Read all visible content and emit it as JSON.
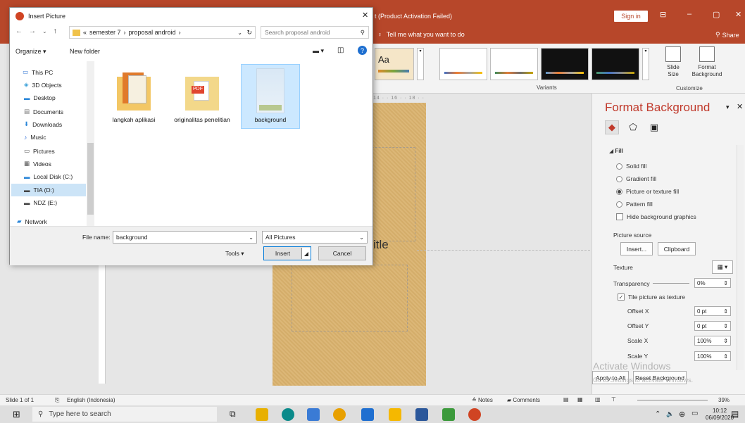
{
  "app": {
    "title": "t (Product Activation Failed)",
    "sign_in": "Sign in",
    "tell_me": "Tell me what you want to do",
    "share": "Share",
    "win_controls": [
      "⊟",
      "–",
      "▢",
      "✕"
    ]
  },
  "ribbon": {
    "variants_label": "Variants",
    "customize_label": "Customize",
    "theme_label": "Aa",
    "slide_size": "Slide\nSize",
    "format_background": "Format\nBackground"
  },
  "dialog": {
    "title": "Insert Picture",
    "breadcrumb": [
      "«",
      "semester 7",
      "›",
      "proposal android",
      "›"
    ],
    "search_placeholder": "Search proposal android",
    "organize": "Organize ▾",
    "new_folder": "New folder",
    "nav_items": [
      {
        "label": "This PC",
        "icon": "pc-icon"
      },
      {
        "label": "3D Objects",
        "icon": "cube-icon"
      },
      {
        "label": "Desktop",
        "icon": "desktop-icon"
      },
      {
        "label": "Documents",
        "icon": "document-icon"
      },
      {
        "label": "Downloads",
        "icon": "download-icon"
      },
      {
        "label": "Music",
        "icon": "music-icon"
      },
      {
        "label": "Pictures",
        "icon": "pictures-icon"
      },
      {
        "label": "Videos",
        "icon": "video-icon"
      },
      {
        "label": "Local Disk (C:)",
        "icon": "disk-icon"
      },
      {
        "label": "TIA (D:)",
        "icon": "drive-icon"
      },
      {
        "label": "NDZ (E:)",
        "icon": "drive-icon"
      },
      {
        "label": "Network",
        "icon": "network-icon"
      }
    ],
    "files": [
      {
        "name": "langkah aplikasi",
        "icon": "folder-icon"
      },
      {
        "name": "originalitas penelitian",
        "icon": "folder-pdf-icon"
      },
      {
        "name": "background",
        "icon": "image-file-icon"
      }
    ],
    "filename_label": "File name:",
    "filename_value": "background",
    "filetype": "All Pictures",
    "tools": "Tools",
    "insert": "Insert",
    "cancel": "Cancel"
  },
  "slide": {
    "title_fragment": "itle"
  },
  "format_panel": {
    "title": "Format Background",
    "fill_header": "Fill",
    "options": [
      "Solid fill",
      "Gradient fill",
      "Picture or texture fill",
      "Pattern fill"
    ],
    "selected_option": 2,
    "hide_bg": "Hide background graphics",
    "picture_source": "Picture source",
    "insert_btn": "Insert...",
    "clipboard_btn": "Clipboard",
    "texture": "Texture",
    "transparency": "Transparency",
    "transparency_value": "0%",
    "tile": "Tile picture as texture",
    "offset_x": "Offset X",
    "offset_x_value": "0 pt",
    "offset_y": "Offset Y",
    "offset_y_value": "0 pt",
    "scale_x": "Scale X",
    "scale_x_value": "100%",
    "scale_y": "Scale Y",
    "scale_y_value": "100%",
    "apply_all": "Apply to All",
    "reset_bg": "Reset Background"
  },
  "watermark": {
    "line1": "Activate Windows",
    "line2": "Go to Settings to activate Windows."
  },
  "status": {
    "slide": "Slide 1 of 1",
    "language": "English (Indonesia)",
    "notes": "Notes",
    "comments": "Comments",
    "zoom": "39%"
  },
  "taskbar": {
    "search": "Type here to search",
    "time": "10:12",
    "date": "06/09/2020"
  },
  "colors": {
    "accent": "#b7472a",
    "selection": "#cce8ff"
  }
}
